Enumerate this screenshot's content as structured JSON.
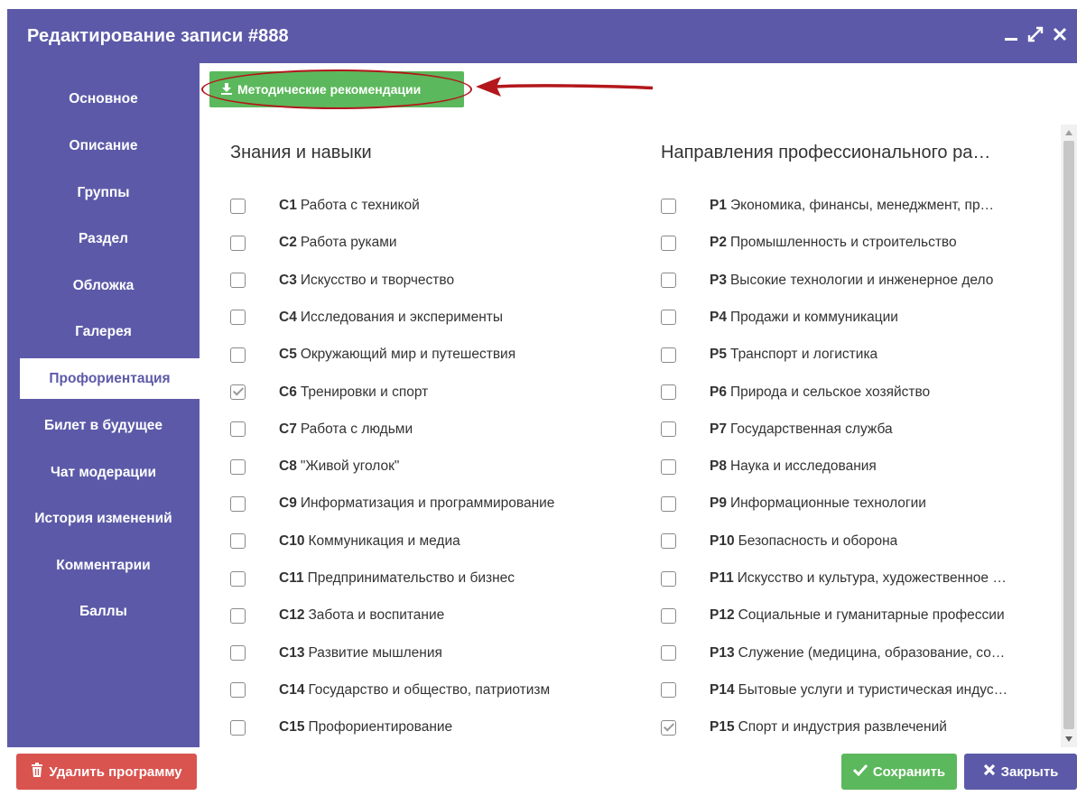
{
  "window": {
    "title": "Редактирование записи #888",
    "controls": [
      "minimize-icon",
      "maximize-icon",
      "close-icon"
    ]
  },
  "sidebar": {
    "items": [
      {
        "label": "Основное"
      },
      {
        "label": "Описание"
      },
      {
        "label": "Группы"
      },
      {
        "label": "Раздел"
      },
      {
        "label": "Обложка"
      },
      {
        "label": "Галерея"
      },
      {
        "label": "Профориентация",
        "active": true
      },
      {
        "label": "Билет в будущее"
      },
      {
        "label": "Чат модерации"
      },
      {
        "label": "История изменений"
      },
      {
        "label": "Комментарии"
      },
      {
        "label": "Баллы"
      }
    ]
  },
  "toolbar": {
    "recommendations_label": "Методические рекомендации",
    "recommendations_icon": "download-icon"
  },
  "skills": {
    "title": "Знания и навыки",
    "items": [
      {
        "code": "С1",
        "label": "Работа с техникой",
        "checked": false
      },
      {
        "code": "С2",
        "label": "Работа руками",
        "checked": false
      },
      {
        "code": "С3",
        "label": "Искусство и творчество",
        "checked": false
      },
      {
        "code": "С4",
        "label": "Исследования и эксперименты",
        "checked": false
      },
      {
        "code": "С5",
        "label": "Окружающий мир и путешествия",
        "checked": false
      },
      {
        "code": "С6",
        "label": "Тренировки и спорт",
        "checked": true
      },
      {
        "code": "С7",
        "label": "Работа с людьми",
        "checked": false
      },
      {
        "code": "С8",
        "label": "\"Живой уголок\"",
        "checked": false
      },
      {
        "code": "С9",
        "label": "Информатизация и программирование",
        "checked": false
      },
      {
        "code": "С10",
        "label": "Коммуникация и медиа",
        "checked": false
      },
      {
        "code": "С11",
        "label": "Предпринимательство и бизнес",
        "checked": false
      },
      {
        "code": "С12",
        "label": "Забота и воспитание",
        "checked": false
      },
      {
        "code": "С13",
        "label": "Развитие мышления",
        "checked": false
      },
      {
        "code": "С14",
        "label": "Государство и общество, патриотизм",
        "checked": false
      },
      {
        "code": "С15",
        "label": "Профориентирование",
        "checked": false
      }
    ]
  },
  "directions": {
    "title": "Направления профессионального ра…",
    "items": [
      {
        "code": "Р1",
        "label": "Экономика, финансы, менеджмент, пр…",
        "checked": false
      },
      {
        "code": "Р2",
        "label": "Промышленность и строительство",
        "checked": false
      },
      {
        "code": "Р3",
        "label": "Высокие технологии и инженерное дело",
        "checked": false
      },
      {
        "code": "Р4",
        "label": "Продажи и коммуникации",
        "checked": false
      },
      {
        "code": "Р5",
        "label": "Транспорт и логистика",
        "checked": false
      },
      {
        "code": "Р6",
        "label": "Природа и сельское хозяйство",
        "checked": false
      },
      {
        "code": "Р7",
        "label": "Государственная служба",
        "checked": false
      },
      {
        "code": "Р8",
        "label": "Наука и исследования",
        "checked": false
      },
      {
        "code": "Р9",
        "label": "Информационные технологии",
        "checked": false
      },
      {
        "code": "Р10",
        "label": "Безопасность и оборона",
        "checked": false
      },
      {
        "code": "Р11",
        "label": "Искусство и культура, художественное …",
        "checked": false
      },
      {
        "code": "Р12",
        "label": "Социальные и гуманитарные профессии",
        "checked": false
      },
      {
        "code": "Р13",
        "label": "Служение (медицина, образование, со…",
        "checked": false
      },
      {
        "code": "Р14",
        "label": "Бытовые услуги и туристическая индус…",
        "checked": false
      },
      {
        "code": "Р15",
        "label": "Спорт и индустрия развлечений",
        "checked": true
      }
    ]
  },
  "footer": {
    "delete_label": "Удалить программу",
    "save_label": "Сохранить",
    "close_label": "Закрыть"
  },
  "colors": {
    "primary": "#5c5aa8",
    "success": "#5cb85c",
    "danger": "#d9534f",
    "annotation": "#b3171b"
  }
}
